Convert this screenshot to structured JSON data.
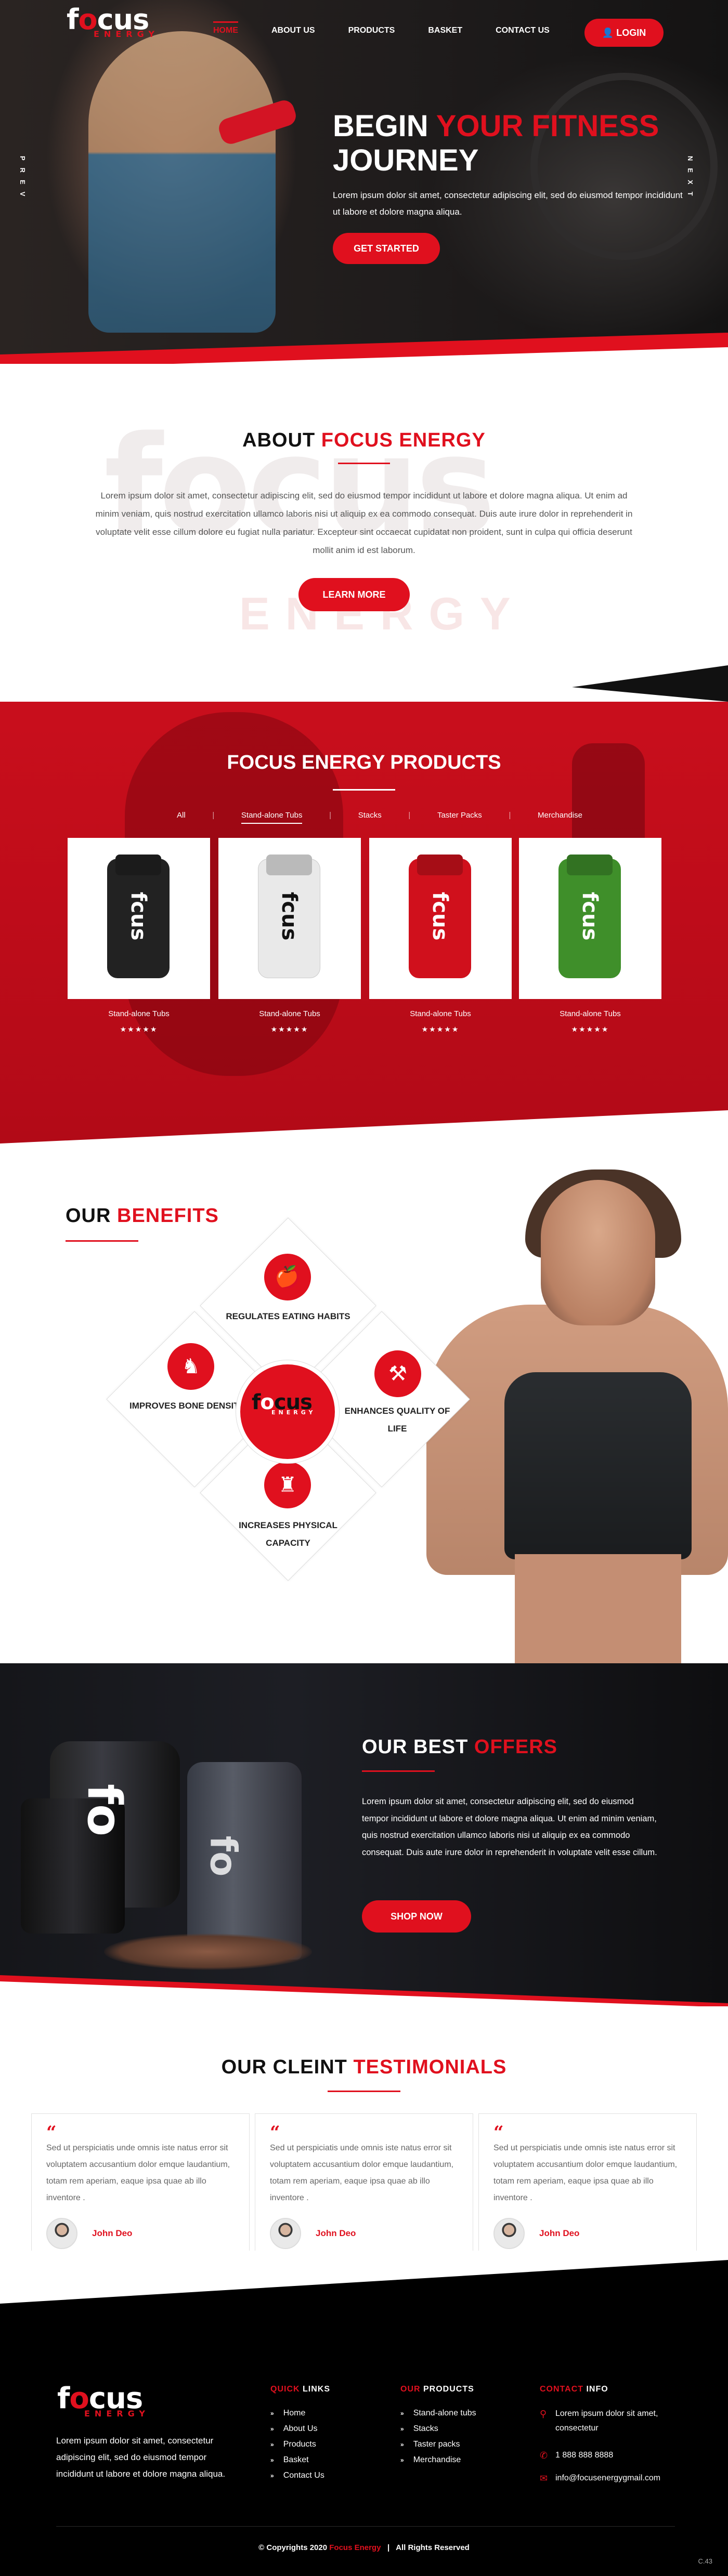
{
  "nav": {
    "logo_main": "focus",
    "logo_sub": "ENERGY",
    "links": [
      "HOME",
      "ABOUT US",
      "PRODUCTS",
      "BASKET",
      "CONTACT US"
    ],
    "login": "LOGIN"
  },
  "hero": {
    "prev": "PREV",
    "next": "NEXT",
    "title_line1_white": "BEGIN ",
    "title_line1_red": "YOUR FITNESS",
    "title_line2": "JOURNEY",
    "text": "Lorem ipsum dolor sit amet, consectetur adipiscing elit, sed do eiusmod tempor incididunt ut labore et dolore magna aliqua.",
    "cta": "GET STARTED"
  },
  "about": {
    "title_black": "ABOUT ",
    "title_red": "FOCUS ENERGY",
    "text": "Lorem ipsum dolor sit amet, consectetur adipiscing elit, sed do eiusmod tempor incididunt ut labore et dolore magna aliqua. Ut enim ad minim veniam, quis nostrud exercitation ullamco laboris nisi ut aliquip ex ea commodo consequat. Duis aute irure dolor in reprehenderit in voluptate velit esse cillum dolore eu fugiat nulla pariatur. Excepteur sint occaecat cupidatat non proident, sunt in culpa qui officia deserunt mollit anim id est laborum.",
    "cta": "LEARN MORE",
    "watermark": "focus",
    "watermark_sub": "ENERGY"
  },
  "products": {
    "title": "FOCUS ENERGY PRODUCTS",
    "filters": [
      "All",
      "Stand-alone Tubs",
      "Stacks",
      "Taster Packs",
      "Merchandise"
    ],
    "items": [
      {
        "name": "Stand-alone Tubs",
        "stars": "★★★★★",
        "color": "#222222"
      },
      {
        "name": "Stand-alone Tubs",
        "stars": "★★★★★",
        "color": "#e9e9e9"
      },
      {
        "name": "Stand-alone Tubs",
        "stars": "★★★★★",
        "color": "#d0101c"
      },
      {
        "name": "Stand-alone Tubs",
        "stars": "★★★★★",
        "color": "#3f8f2a"
      }
    ]
  },
  "benefits": {
    "title_black": "OUR ",
    "title_red": "BENEFITS",
    "items": [
      "REGULATES EATING HABITS",
      "ENHANCES QUALITY OF LIFE",
      "INCREASES PHYSICAL CAPACITY",
      "IMPROVES BONE DENSITY"
    ]
  },
  "offers": {
    "title_white": "OUR BEST ",
    "title_red": "OFFERS",
    "text": "Lorem ipsum dolor sit amet, consectetur adipiscing elit, sed do eiusmod tempor incididunt ut labore et dolore magna aliqua. Ut enim ad minim veniam, quis nostrud exercitation ullamco laboris nisi ut aliquip ex ea commodo consequat. Duis aute irure dolor in reprehenderit in voluptate velit esse cillum.",
    "cta": "SHOP NOW"
  },
  "testimonials": {
    "title_black": "OUR CLEINT ",
    "title_red": "TESTIMONIALS",
    "items": [
      {
        "quote": "Sed ut perspiciatis unde omnis iste natus error sit voluptatem accusantium dolor emque laudantium, totam rem aperiam, eaque ipsa quae ab illo inventore .",
        "name": "John Deo"
      },
      {
        "quote": "Sed ut perspiciatis unde omnis iste natus error sit voluptatem accusantium dolor emque laudantium, totam rem aperiam, eaque ipsa quae ab illo inventore .",
        "name": "John Deo"
      },
      {
        "quote": "Sed ut perspiciatis unde omnis iste natus error sit voluptatem accusantium dolor emque laudantium, totam rem aperiam, eaque ipsa quae ab illo inventore .",
        "name": "John Deo"
      }
    ]
  },
  "footer": {
    "about": "Lorem ipsum dolor sit amet, consectetur adipiscing elit, sed do eiusmod tempor incididunt ut labore et dolore magna aliqua.",
    "quick_red": "QUICK",
    "quick_white": " LINKS",
    "quick_links": [
      "Home",
      "About Us",
      "Products",
      "Basket",
      "Contact Us"
    ],
    "products_red": "OUR",
    "products_white": " PRODUCTS",
    "product_links": [
      "Stand-alone tubs",
      "Stacks",
      "Taster packs",
      "Merchandise"
    ],
    "contact_red": "CONTACT",
    "contact_white": " INFO",
    "address": "Lorem ipsum dolor sit amet, consectetur",
    "phone": "1 888 888 8888",
    "email": "info@focusenergygmail.com",
    "copy_pre": "© Copyrights 2020 ",
    "copy_brand": "Focus Energy",
    "copy_sep": "   |   ",
    "copy_post": "All Rights Reserved",
    "version": "C.43"
  },
  "colors": {
    "accent": "#e0101e",
    "dark": "#111111"
  }
}
